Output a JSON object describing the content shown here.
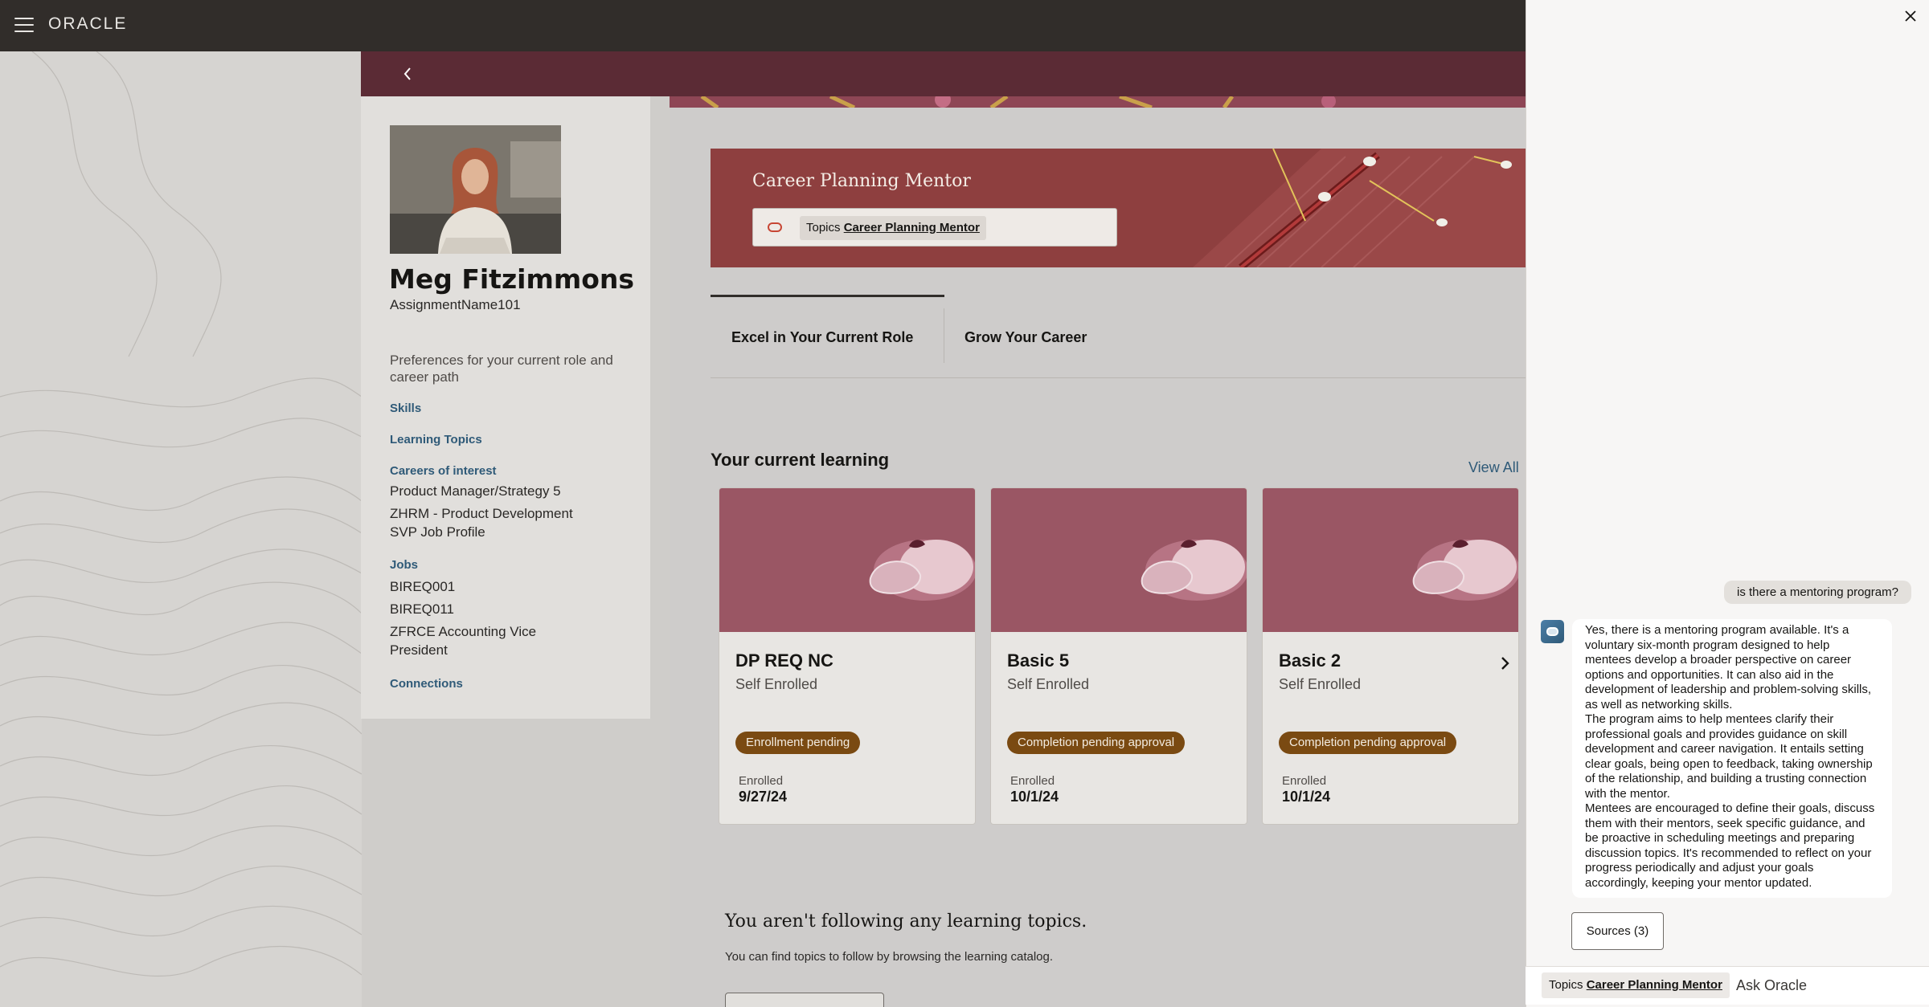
{
  "app": {
    "logo": "ORACLE"
  },
  "profile": {
    "name": "Meg Fitzimmons",
    "assignment": "AssignmentName101",
    "preferences_text": "Preferences for your current role and career path",
    "skills_link": "Skills",
    "learning_topics_link": "Learning Topics",
    "careers_heading": "Careers of interest",
    "careers": [
      "Product Manager/Strategy 5",
      "ZHRM - Product Development SVP Job Profile"
    ],
    "jobs_heading": "Jobs",
    "jobs": [
      "BIREQ001",
      "BIREQ011",
      "ZFRCE Accounting Vice President"
    ],
    "connections_link": "Connections"
  },
  "hero": {
    "title": "Career Planning Mentor",
    "chip_prefix": "Topics",
    "chip_topic": "Career Planning Mentor"
  },
  "tabs": [
    {
      "label": "Excel in Your Current Role",
      "active": true
    },
    {
      "label": "Grow Your Career",
      "active": false
    }
  ],
  "learning": {
    "title": "Your current learning",
    "view_all": "View All",
    "cards": [
      {
        "title": "DP REQ NC",
        "subtitle": "Self Enrolled",
        "status": "Enrollment pending",
        "enrolled_label": "Enrolled",
        "enrolled_date": "9/27/24"
      },
      {
        "title": "Basic 5",
        "subtitle": "Self Enrolled",
        "status": "Completion pending approval",
        "enrolled_label": "Enrolled",
        "enrolled_date": "10/1/24"
      },
      {
        "title": "Basic 2",
        "subtitle": "Self Enrolled",
        "status": "Completion pending approval",
        "enrolled_label": "Enrolled",
        "enrolled_date": "10/1/24"
      }
    ]
  },
  "following": {
    "title": "You aren't following any learning topics.",
    "subtitle": "You can find topics to follow by browsing the learning catalog."
  },
  "assistant": {
    "user_message": "is there a mentoring program?",
    "reply_paragraphs": [
      "Yes, there is a mentoring program available. It's a voluntary six-month program designed to help mentees develop a broader perspective on career options and opportunities. It can also aid in the development of leadership and problem-solving skills, as well as networking skills.",
      "The program aims to help mentees clarify their professional goals and provides guidance on skill development and career navigation. It entails setting clear goals, being open to feedback, taking ownership of the relationship, and building a trusting connection with the mentor.",
      "Mentees are encouraged to define their goals, discuss them with their mentors, seek specific guidance, and be proactive in scheduling meetings and preparing discussion topics. It's recommended to reflect on your progress periodically and adjust your goals accordingly, keeping your mentor updated."
    ],
    "sources_label": "Sources (3)",
    "topic_prefix": "Topics",
    "topic_name": "Career Planning Mentor",
    "input_placeholder": "Ask Oracle"
  },
  "colors": {
    "topbar": "#312d2a",
    "header_strip": "#5b2b35",
    "hero_bg": "#8e3f3f",
    "link": "#2f5a78",
    "badge": "#7a4a12",
    "card_image": "#9a5664"
  }
}
